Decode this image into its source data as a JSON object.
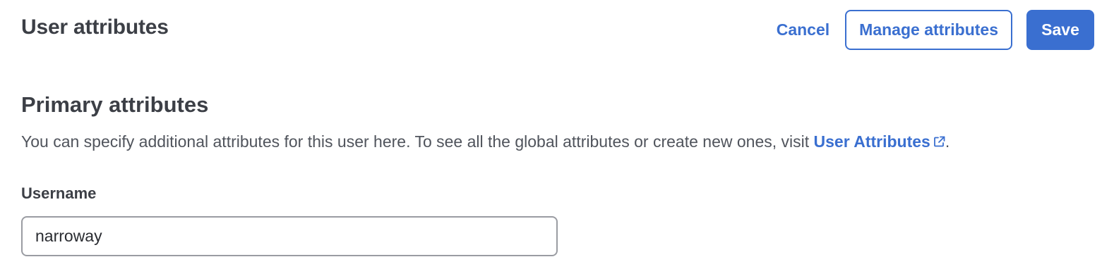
{
  "header": {
    "title": "User attributes"
  },
  "actions": {
    "cancel_label": "Cancel",
    "manage_label": "Manage attributes",
    "save_label": "Save"
  },
  "section": {
    "title": "Primary attributes",
    "description_prefix": "You can specify additional attributes for this user here. To see all the global attributes or create new ones, visit ",
    "link_label": "User Attributes",
    "link_icon": "external-link-icon",
    "description_suffix": "."
  },
  "fields": {
    "username": {
      "label": "Username",
      "value": "narroway"
    }
  },
  "colors": {
    "accent": "#3a6fd0",
    "text": "#3c3f46",
    "input_border": "#9a9ca2"
  }
}
